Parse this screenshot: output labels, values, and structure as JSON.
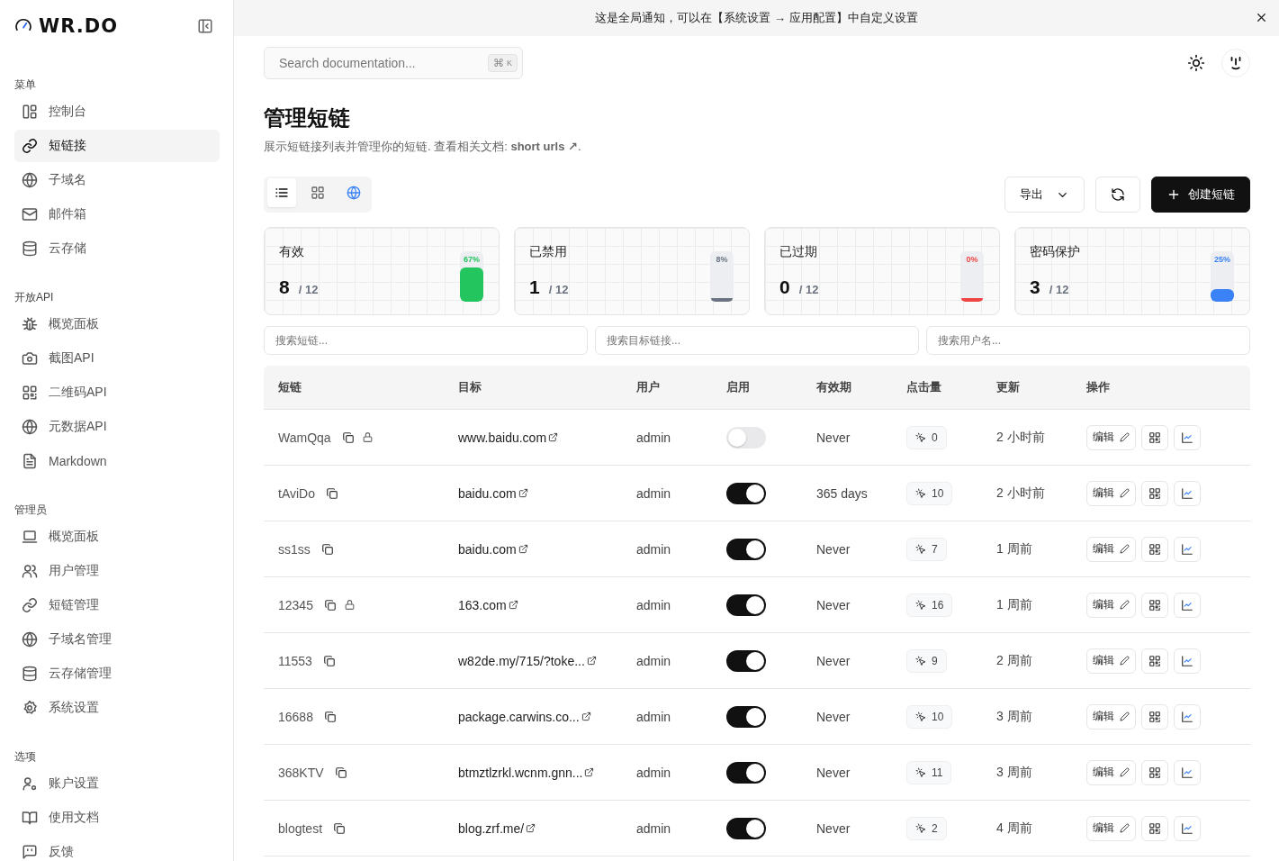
{
  "sidebar": {
    "logo": "WR.DO",
    "sections": [
      {
        "title": "菜单",
        "items": [
          {
            "label": "控制台",
            "selected": false
          },
          {
            "label": "短链接",
            "selected": true
          },
          {
            "label": "子域名",
            "selected": false
          },
          {
            "label": "邮件箱",
            "selected": false
          },
          {
            "label": "云存储",
            "selected": false
          }
        ]
      },
      {
        "title": "开放API",
        "items": [
          {
            "label": "概览面板",
            "selected": false
          },
          {
            "label": "截图API",
            "selected": false
          },
          {
            "label": "二维码API",
            "selected": false
          },
          {
            "label": "元数据API",
            "selected": false
          },
          {
            "label": "Markdown",
            "selected": false
          }
        ]
      },
      {
        "title": "管理员",
        "items": [
          {
            "label": "概览面板",
            "selected": false
          },
          {
            "label": "用户管理",
            "selected": false
          },
          {
            "label": "短链管理",
            "selected": false
          },
          {
            "label": "子域名管理",
            "selected": false
          },
          {
            "label": "云存储管理",
            "selected": false
          },
          {
            "label": "系统设置",
            "selected": false
          }
        ]
      },
      {
        "title": "选项",
        "items": [
          {
            "label": "账户设置",
            "selected": false
          },
          {
            "label": "使用文档",
            "selected": false
          },
          {
            "label": "反馈",
            "selected": false
          }
        ]
      }
    ]
  },
  "notice": {
    "text": "这是全局通知，可以在【系统设置 → 应用配置】中自定义设置"
  },
  "search": {
    "placeholder": "Search documentation...",
    "shortcut": [
      "⌘",
      "K"
    ]
  },
  "page": {
    "title": "管理短链",
    "description": "展示短链接列表并管理你的短链. 查看相关文档: ",
    "link": "short urls ↗",
    "description_end": "."
  },
  "view_toggle": [
    {
      "kind": "list",
      "selected": true
    },
    {
      "kind": "grid",
      "selected": false
    },
    {
      "kind": "globe",
      "selected": false
    }
  ],
  "actions": {
    "export": "导出",
    "create": "创建短链"
  },
  "stats": [
    {
      "label": "有效",
      "value": "8",
      "total": "/ 12",
      "percent": "67%",
      "level": 0.67,
      "color": "#22c55e"
    },
    {
      "label": "已禁用",
      "value": "1",
      "total": "/ 12",
      "percent": "8%",
      "level": 0.08,
      "color": "#6b7280"
    },
    {
      "label": "已过期",
      "value": "0",
      "total": "/ 12",
      "percent": "0%",
      "level": 0,
      "color": "#ef4444"
    },
    {
      "label": "密码保护",
      "value": "3",
      "total": "/ 12",
      "percent": "25%",
      "level": 0.25,
      "color": "#3b82f6"
    }
  ],
  "filters": [
    {
      "placeholder": "搜索短链..."
    },
    {
      "placeholder": "搜索目标链接..."
    },
    {
      "placeholder": "搜索用户名..."
    }
  ],
  "table": {
    "columns": [
      "短链",
      "目标",
      "用户",
      "启用",
      "有效期",
      "点击量",
      "更新",
      "操作"
    ],
    "rows": [
      {
        "slug": "WamQqa",
        "locked": true,
        "target": "www.baidu.com",
        "user": "admin",
        "enabled": false,
        "expiry": "Never",
        "clicks": "0",
        "updated": "2 小时前",
        "edit": "编辑"
      },
      {
        "slug": "tAviDo",
        "locked": false,
        "target": "baidu.com",
        "user": "admin",
        "enabled": true,
        "expiry": "365 days",
        "clicks": "10",
        "updated": "2 小时前",
        "edit": "编辑"
      },
      {
        "slug": "ss1ss",
        "locked": false,
        "target": "baidu.com",
        "user": "admin",
        "enabled": true,
        "expiry": "Never",
        "clicks": "7",
        "updated": "1 周前",
        "edit": "编辑"
      },
      {
        "slug": "12345",
        "locked": true,
        "target": "163.com",
        "user": "admin",
        "enabled": true,
        "expiry": "Never",
        "clicks": "16",
        "updated": "1 周前",
        "edit": "编辑"
      },
      {
        "slug": "11553",
        "locked": false,
        "target": "w82de.my/715/?toke...",
        "user": "admin",
        "enabled": true,
        "expiry": "Never",
        "clicks": "9",
        "updated": "2 周前",
        "edit": "编辑"
      },
      {
        "slug": "16688",
        "locked": false,
        "target": "package.carwins.co...",
        "user": "admin",
        "enabled": true,
        "expiry": "Never",
        "clicks": "10",
        "updated": "3 周前",
        "edit": "编辑"
      },
      {
        "slug": "368KTV",
        "locked": false,
        "target": "btmztlzrkl.wcnm.gnn...",
        "user": "admin",
        "enabled": true,
        "expiry": "Never",
        "clicks": "11",
        "updated": "3 周前",
        "edit": "编辑"
      },
      {
        "slug": "blogtest",
        "locked": false,
        "target": "blog.zrf.me/",
        "user": "admin",
        "enabled": true,
        "expiry": "Never",
        "clicks": "2",
        "updated": "4 周前",
        "edit": "编辑"
      }
    ]
  }
}
